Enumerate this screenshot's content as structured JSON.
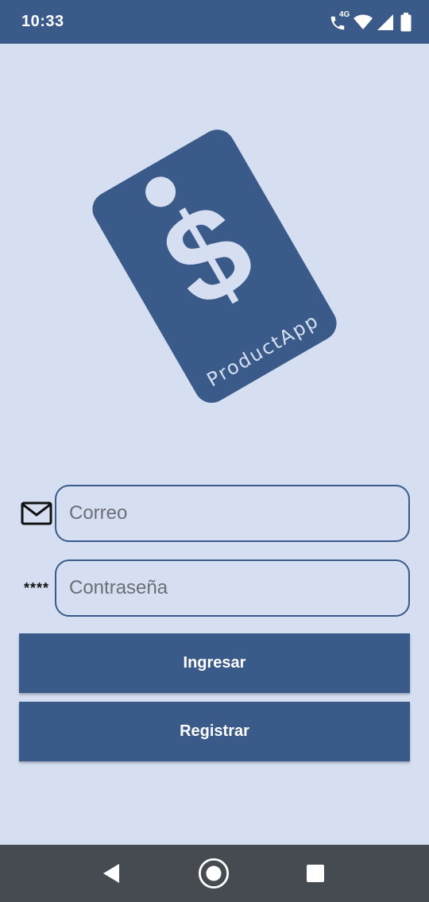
{
  "status_bar": {
    "time": "10:33",
    "network_label": "4G",
    "icons": [
      "phone-wifi-call-icon",
      "wifi-icon",
      "signal-icon",
      "battery-icon"
    ]
  },
  "logo": {
    "brand_text": "ProductApp",
    "symbol": "$",
    "tag_color": "#3a5a89",
    "symbol_color": "#d5dff1"
  },
  "form": {
    "email": {
      "icon": "mail-icon",
      "placeholder": "Correo",
      "value": ""
    },
    "password": {
      "icon_text": "****",
      "placeholder": "Contraseña",
      "value": ""
    }
  },
  "buttons": {
    "login_label": "Ingresar",
    "register_label": "Registrar"
  },
  "nav_bar": {
    "icons": [
      "back-icon",
      "home-icon",
      "recents-icon"
    ]
  },
  "colors": {
    "primary": "#3a5a89",
    "background": "#d5dff1",
    "nav": "#454b51"
  }
}
